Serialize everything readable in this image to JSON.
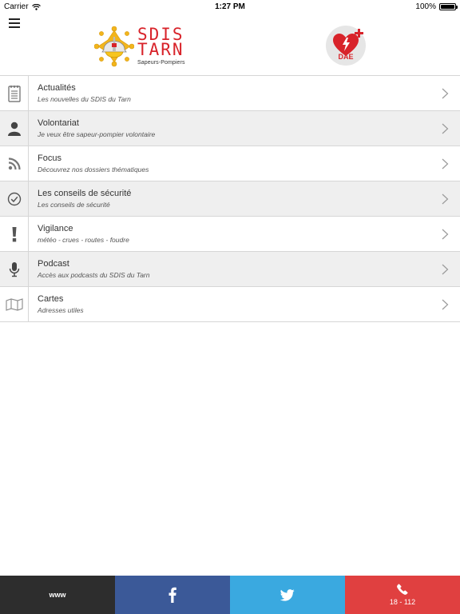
{
  "status_bar": {
    "carrier": "Carrier",
    "time": "1:27 PM",
    "battery": "100%"
  },
  "header": {
    "logo_line1": "SDIS",
    "logo_line2": "TARN",
    "logo_subtitle": "Sapeurs-Pompiers",
    "dae_label": "DAE"
  },
  "menu": [
    {
      "title": "Actualités",
      "subtitle": "Les nouvelles du SDIS du Tarn",
      "icon": "calendar-icon"
    },
    {
      "title": "Volontariat",
      "subtitle": "Je veux être sapeur-pompier volontaire",
      "icon": "person-icon"
    },
    {
      "title": "Focus",
      "subtitle": "Découvrez nos dossiers thématiques",
      "icon": "rss-icon"
    },
    {
      "title": "Les conseils de sécurité",
      "subtitle": "Les conseils de sécurité",
      "icon": "check-circle-icon"
    },
    {
      "title": "Vigilance",
      "subtitle": "météo - crues - routes - foudre",
      "icon": "exclamation-icon"
    },
    {
      "title": "Podcast",
      "subtitle": "Accès aux podcasts du SDIS du Tarn",
      "icon": "microphone-icon"
    },
    {
      "title": "Cartes",
      "subtitle": "Adresses utiles",
      "icon": "map-icon"
    }
  ],
  "bottom_bar": {
    "www_label": "www",
    "call_label": "18 - 112"
  },
  "colors": {
    "brand_red": "#d8232a",
    "facebook": "#3b5998",
    "twitter": "#3aa9e0",
    "call": "#e04040",
    "www": "#2d2d2d"
  }
}
